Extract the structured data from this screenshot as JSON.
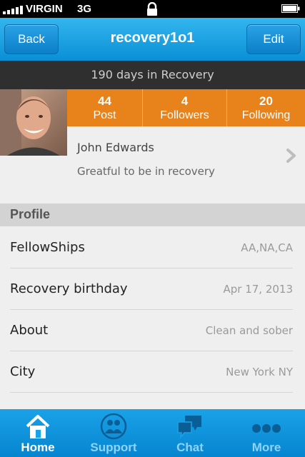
{
  "status_bar": {
    "carrier": "VIRGIN",
    "network": "3G"
  },
  "nav": {
    "back_label": "Back",
    "title": "recovery1o1",
    "edit_label": "Edit"
  },
  "banner": {
    "text": "190 days in Recovery"
  },
  "stats": [
    {
      "value": "44",
      "label": "Post"
    },
    {
      "value": "4",
      "label": "Followers"
    },
    {
      "value": "20",
      "label": "Following"
    }
  ],
  "user": {
    "name": "John Edwards",
    "tagline": "Greatful to be in recovery"
  },
  "profile_section": {
    "title": "Profile",
    "rows": [
      {
        "key": "FellowShips",
        "value": "AA,NA,CA"
      },
      {
        "key": "Recovery birthday",
        "value": "Apr 17, 2013"
      },
      {
        "key": "About",
        "value": "Clean and sober"
      },
      {
        "key": "City",
        "value": "New York NY"
      }
    ]
  },
  "tabbar": {
    "tabs": [
      {
        "label": "Home",
        "icon": "home-icon",
        "active": true
      },
      {
        "label": "Support",
        "icon": "people-icon",
        "active": false
      },
      {
        "label": "Chat",
        "icon": "chat-icon",
        "active": false
      },
      {
        "label": "More",
        "icon": "more-icon",
        "active": false
      }
    ]
  },
  "colors": {
    "nav_blue": "#0a8fd6",
    "accent_orange": "#e8821a",
    "banner_dark": "#2f2f2f"
  }
}
